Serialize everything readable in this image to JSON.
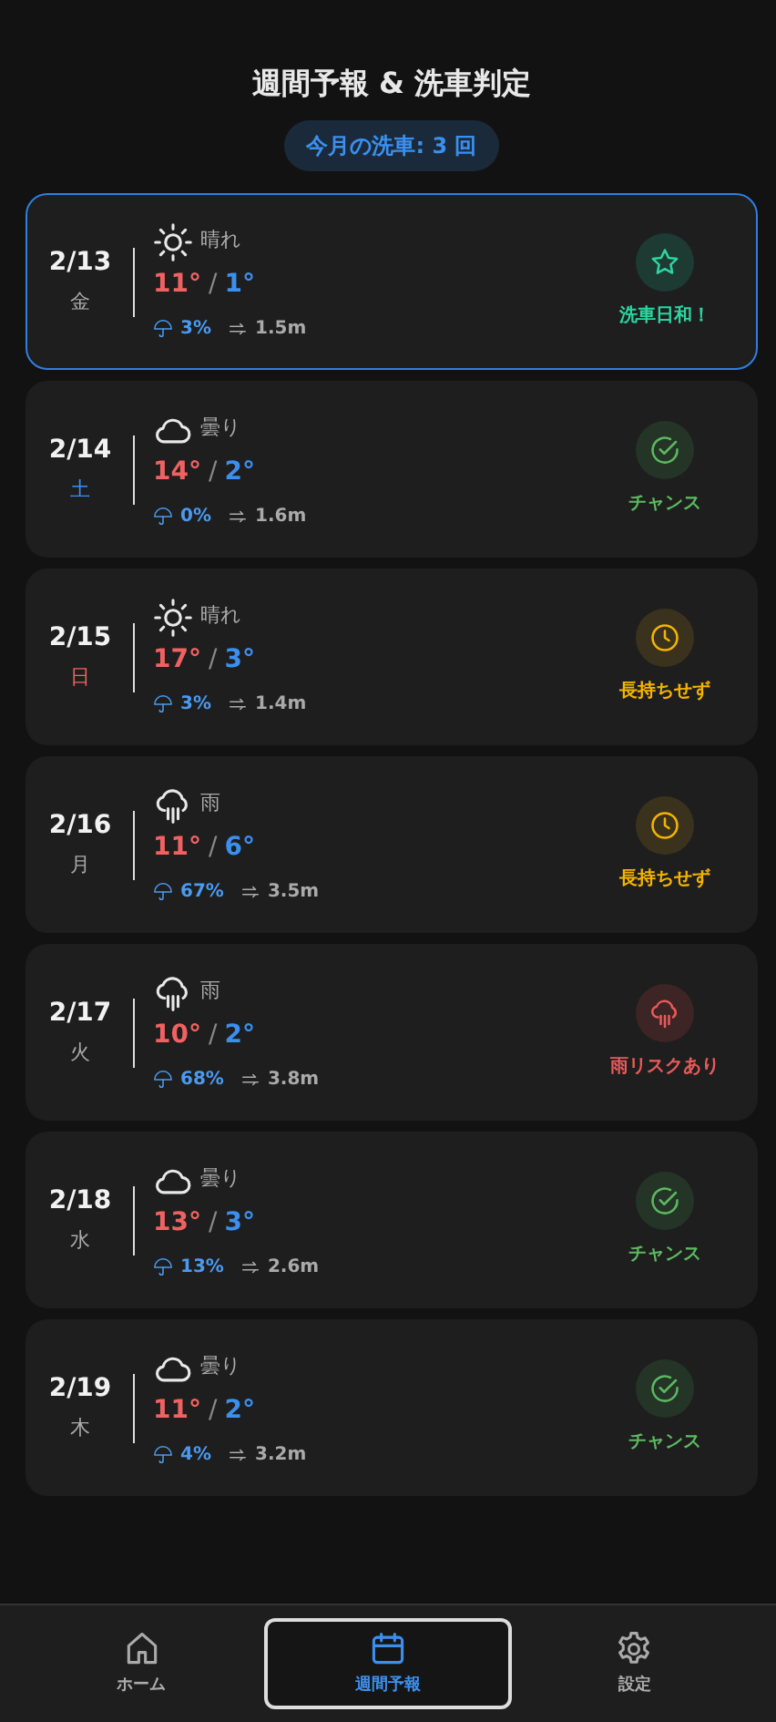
{
  "title": "週間予報 & 洗車判定",
  "monthly_badge": "今月の洗車: 3 回",
  "days": [
    {
      "date": "2/13",
      "weekday": "金",
      "color": "#aaaaaa",
      "separator": "/",
      "highlighted": true,
      "weather": {
        "kind": "sunny",
        "label": "晴れ"
      },
      "high": "11°",
      "low": "1°",
      "rain": "3%",
      "wind": "1.5m",
      "verdict": {
        "kind": "best",
        "label": "洗車日和！"
      }
    },
    {
      "date": "2/14",
      "weekday": "土",
      "color": "#3b8fef",
      "separator": "/",
      "highlighted": false,
      "weather": {
        "kind": "cloudy",
        "label": "曇り"
      },
      "high": "14°",
      "low": "2°",
      "rain": "0%",
      "wind": "1.6m",
      "verdict": {
        "kind": "chance",
        "label": "チャンス"
      }
    },
    {
      "date": "2/15",
      "weekday": "日",
      "color": "#f06262",
      "separator": "/",
      "highlighted": false,
      "weather": {
        "kind": "sunny",
        "label": "晴れ"
      },
      "high": "17°",
      "low": "3°",
      "rain": "3%",
      "wind": "1.4m",
      "verdict": {
        "kind": "short",
        "label": "長持ちせず"
      }
    },
    {
      "date": "2/16",
      "weekday": "月",
      "color": "#aaaaaa",
      "separator": "/",
      "highlighted": false,
      "weather": {
        "kind": "rain",
        "label": "雨"
      },
      "high": "11°",
      "low": "6°",
      "rain": "67%",
      "wind": "3.5m",
      "verdict": {
        "kind": "short",
        "label": "長持ちせず"
      }
    },
    {
      "date": "2/17",
      "weekday": "火",
      "color": "#aaaaaa",
      "separator": "/",
      "highlighted": false,
      "weather": {
        "kind": "rain",
        "label": "雨"
      },
      "high": "10°",
      "low": "2°",
      "rain": "68%",
      "wind": "3.8m",
      "verdict": {
        "kind": "risk",
        "label": "雨リスクあり"
      }
    },
    {
      "date": "2/18",
      "weekday": "水",
      "color": "#aaaaaa",
      "separator": "/",
      "highlighted": false,
      "weather": {
        "kind": "cloudy",
        "label": "曇り"
      },
      "high": "13°",
      "low": "3°",
      "rain": "13%",
      "wind": "2.6m",
      "verdict": {
        "kind": "chance",
        "label": "チャンス"
      }
    },
    {
      "date": "2/19",
      "weekday": "木",
      "color": "#aaaaaa",
      "separator": "/",
      "highlighted": false,
      "weather": {
        "kind": "cloudy",
        "label": "曇り"
      },
      "high": "11°",
      "low": "2°",
      "rain": "4%",
      "wind": "3.2m",
      "verdict": {
        "kind": "chance",
        "label": "チャンス"
      }
    }
  ],
  "nav": [
    {
      "kind": "home",
      "label": "ホーム",
      "selected": false
    },
    {
      "kind": "calendar",
      "label": "週間予報",
      "selected": true
    },
    {
      "kind": "settings",
      "label": "設定",
      "selected": false
    }
  ]
}
